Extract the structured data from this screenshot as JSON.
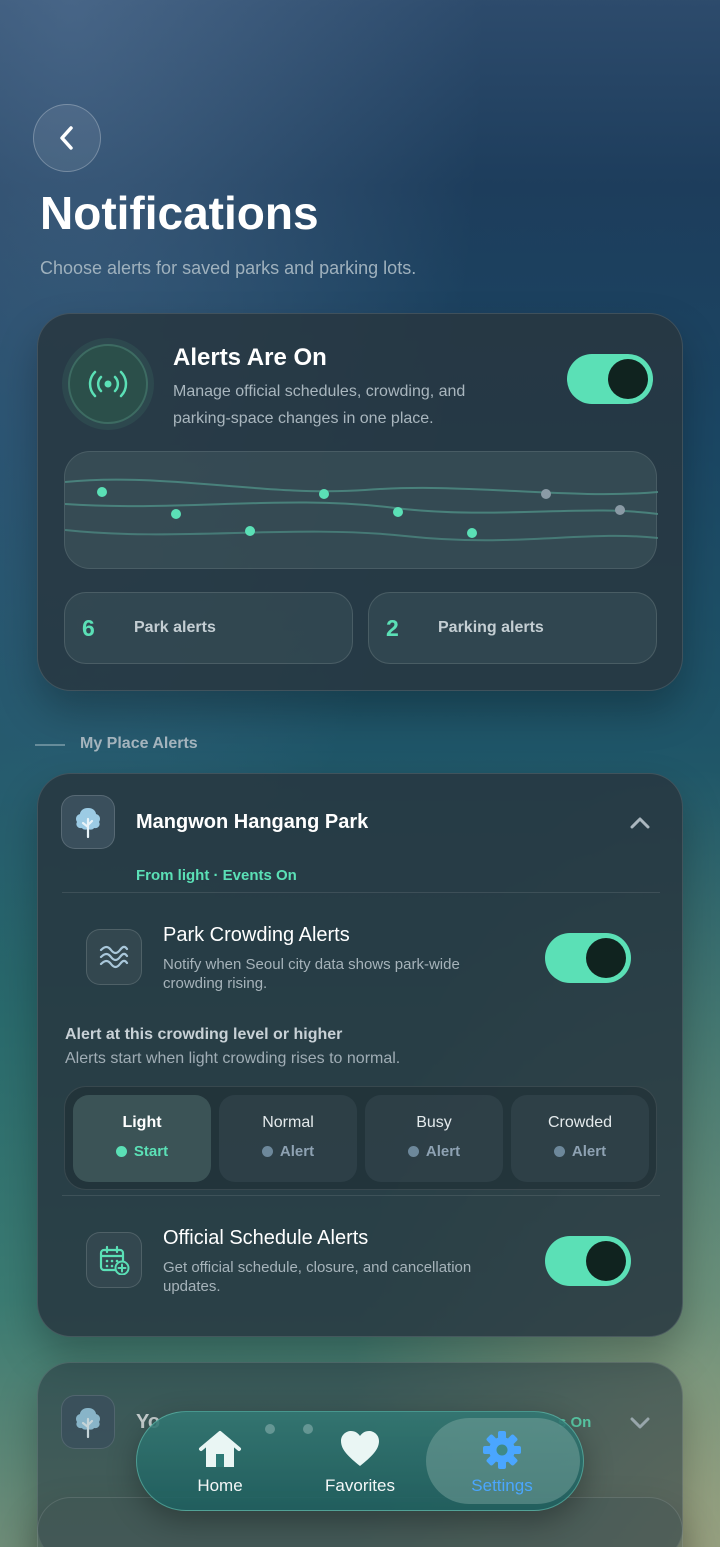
{
  "header": {
    "title": "Notifications",
    "subtitle": "Choose alerts for saved parks and parking lots."
  },
  "summary": {
    "title": "Alerts Are On",
    "description": "Manage official schedules, crowding, and parking-space changes in one place.",
    "toggle_on": true,
    "stats": [
      {
        "count": "6",
        "label": "Park alerts"
      },
      {
        "count": "2",
        "label": "Parking alerts"
      }
    ]
  },
  "section": {
    "label": "My Place Alerts"
  },
  "place": {
    "name": "Mangwon Hangang Park",
    "status": "From light · Events On",
    "crowding": {
      "title": "Park Crowding Alerts",
      "description": "Notify when Seoul city data shows park-wide crowding rising.",
      "toggle_on": true
    },
    "level": {
      "title": "Alert at this crowding level or higher",
      "subtitle": "Alerts start when light crowding rises to normal.",
      "options": [
        {
          "name": "Light",
          "tag": "Start",
          "selected": true
        },
        {
          "name": "Normal",
          "tag": "Alert",
          "selected": false
        },
        {
          "name": "Busy",
          "tag": "Alert",
          "selected": false
        },
        {
          "name": "Crowded",
          "tag": "Alert",
          "selected": false
        }
      ]
    },
    "schedule": {
      "title": "Official Schedule Alerts",
      "description": "Get official schedule, closure, and cancellation updates.",
      "toggle_on": true
    }
  },
  "place2": {
    "name_partial": "Yo",
    "status_partial": "s On"
  },
  "tabbar": {
    "items": [
      {
        "label": "Home",
        "icon": "home-icon"
      },
      {
        "label": "Favorites",
        "icon": "heart-icon"
      },
      {
        "label": "Settings",
        "icon": "gear-icon"
      }
    ],
    "active": "Settings"
  },
  "colors": {
    "accent": "#5be0b6",
    "active_tab": "#4aa6ff"
  }
}
